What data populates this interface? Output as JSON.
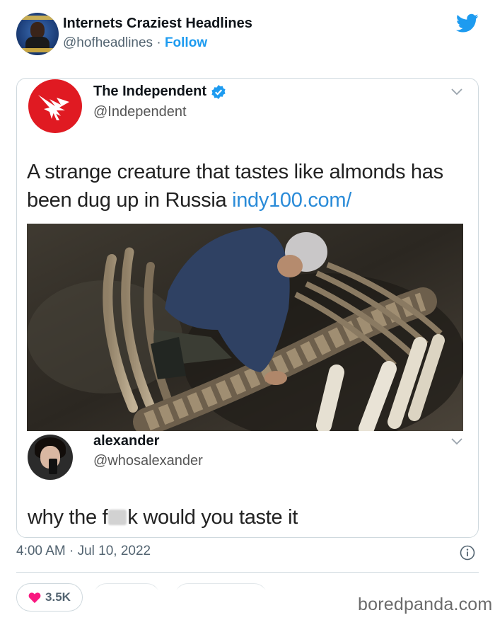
{
  "account": {
    "name": "Internets Craziest Headlines",
    "handle": "@hofheadlines",
    "separator": " · ",
    "follow_label": "Follow"
  },
  "embedded": {
    "source_name": "The Independent",
    "source_handle": "@Independent",
    "headline": "A strange creature that tastes like almonds has been dug up in Russia",
    "link": "indy100.com/",
    "reply_name": "alexander",
    "reply_handle": "@whosalexander",
    "reply_text_before": "why the f",
    "reply_text_after": "k would you taste it"
  },
  "footer": {
    "timestamp": "4:00 AM · Jul 10, 2022",
    "likes": "3.5K"
  },
  "watermark": "boredpanda.com",
  "icons": {
    "brand": "twitter-bird-icon",
    "verified": "verified-badge-icon",
    "menu": "chevron-down-icon",
    "info": "info-icon",
    "like": "heart-icon"
  },
  "colors": {
    "twitter_blue": "#1d9bf0",
    "like_red": "#f91880",
    "independent_red": "#e01a22",
    "text_secondary": "#536471"
  }
}
